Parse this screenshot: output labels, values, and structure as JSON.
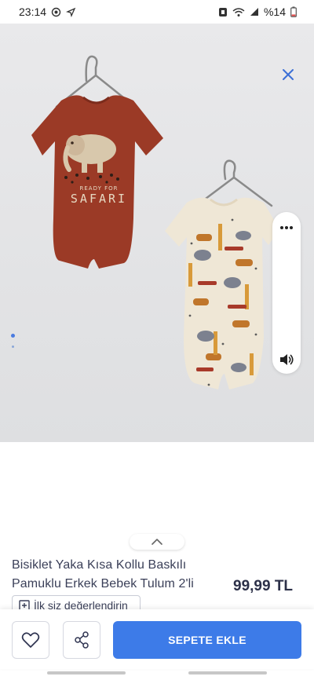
{
  "status_bar": {
    "time": "23:14",
    "battery": "%14",
    "icons": [
      "sync-icon",
      "navigation-icon",
      "nfc-icon",
      "wifi-icon",
      "signal-icon",
      "battery-icon"
    ]
  },
  "gallery": {
    "close_icon": "close-icon",
    "more_icon": "more-dots-icon",
    "sound_icon": "speaker-icon",
    "printed_text": [
      "READY FOR",
      "SAFARI"
    ]
  },
  "product": {
    "title": "Bisiklet Yaka Kısa Kollu Baskılı Pamuklu Erkek Bebek Tulum 2'li",
    "price": "99,99 TL",
    "review_label": "İlk siz değerlendirin"
  },
  "actions": {
    "favorite_icon": "heart-icon",
    "share_icon": "share-icon",
    "add_to_cart_label": "SEPETE EKLE"
  },
  "colors": {
    "accent": "#3d7be8",
    "close": "#3b6fd6",
    "image_background": "#e3e3e5"
  }
}
